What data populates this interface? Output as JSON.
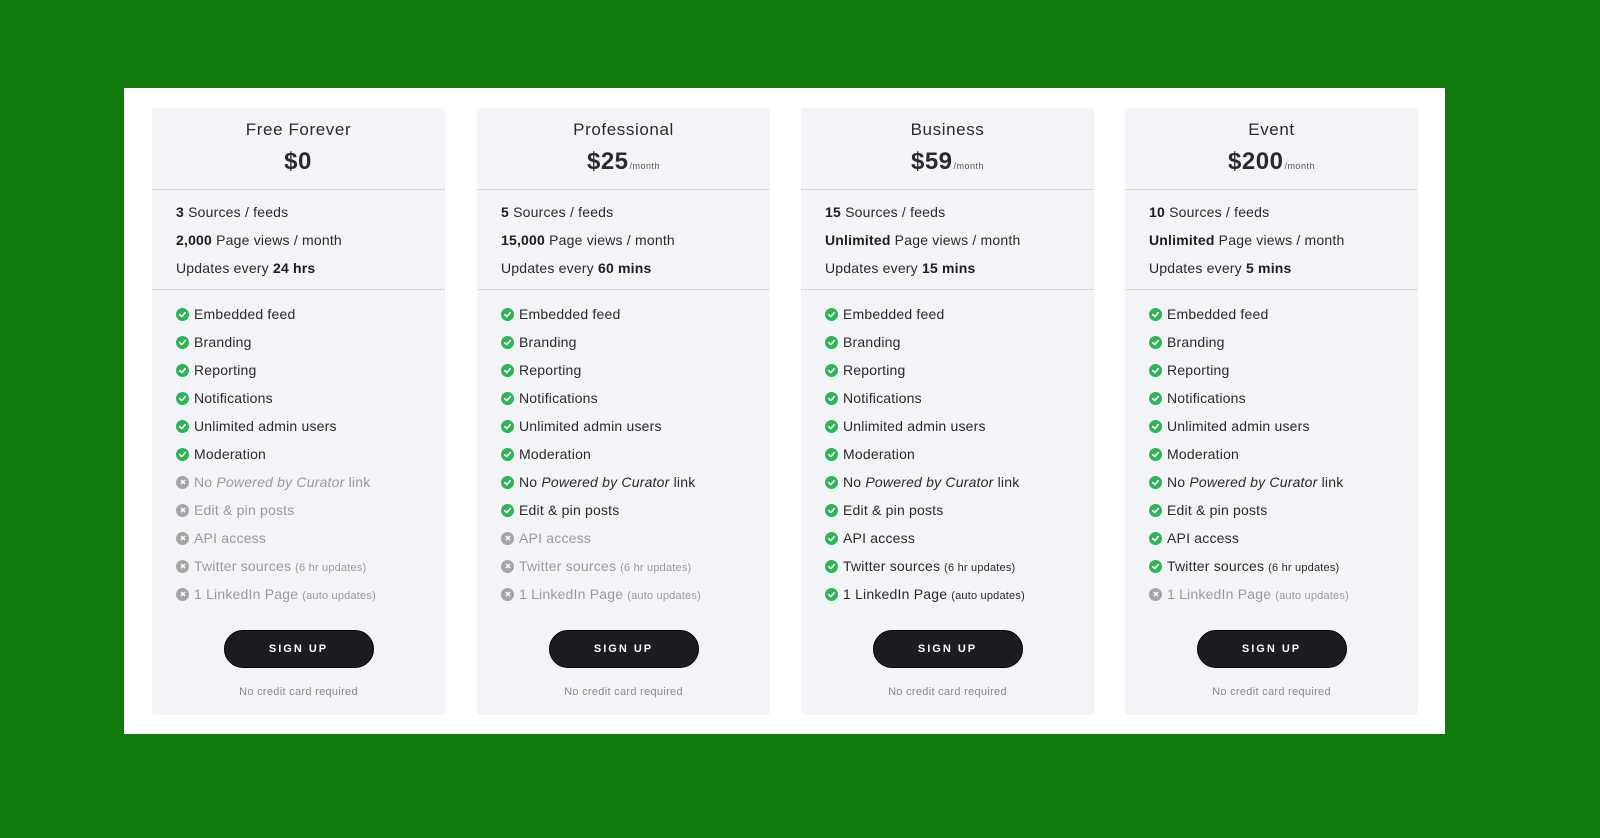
{
  "colors": {
    "background": "#107a0c",
    "frame": "#ffffff",
    "card": "#f3f4f8",
    "check": "#2fb45a",
    "cross": "#a5a5a5",
    "button": "#1c1c22"
  },
  "plans": [
    {
      "name": "Free Forever",
      "price": "$0",
      "period": "",
      "limits": [
        {
          "strong": "3",
          "text": " Sources / feeds"
        },
        {
          "strong": "2,000",
          "text": " Page views / month"
        },
        {
          "pre": "Updates every ",
          "strong": "24 hrs"
        }
      ],
      "features": [
        {
          "label": "Embedded feed",
          "on": true
        },
        {
          "label": "Branding",
          "on": true
        },
        {
          "label": "Reporting",
          "on": true
        },
        {
          "label": "Notifications",
          "on": true
        },
        {
          "label": "Unlimited admin users",
          "on": true
        },
        {
          "label": "Moderation",
          "on": true
        },
        {
          "pre": "No ",
          "em": "Powered by Curator",
          "post": " link",
          "on": false
        },
        {
          "label": "Edit & pin posts",
          "on": false
        },
        {
          "label": "API access",
          "on": false
        },
        {
          "label": "Twitter sources",
          "small": "(6 hr updates)",
          "on": false
        },
        {
          "label": "1 LinkedIn Page",
          "small": "(auto updates)",
          "on": false
        }
      ],
      "button": "SIGN UP",
      "note": "No credit card required"
    },
    {
      "name": "Professional",
      "price": "$25",
      "period": "/month",
      "limits": [
        {
          "strong": "5",
          "text": " Sources / feeds"
        },
        {
          "strong": "15,000",
          "text": " Page views / month"
        },
        {
          "pre": "Updates every ",
          "strong": "60 mins"
        }
      ],
      "features": [
        {
          "label": "Embedded feed",
          "on": true
        },
        {
          "label": "Branding",
          "on": true
        },
        {
          "label": "Reporting",
          "on": true
        },
        {
          "label": "Notifications",
          "on": true
        },
        {
          "label": "Unlimited admin users",
          "on": true
        },
        {
          "label": "Moderation",
          "on": true
        },
        {
          "pre": "No ",
          "em": "Powered by Curator",
          "post": " link",
          "on": true
        },
        {
          "label": "Edit & pin posts",
          "on": true
        },
        {
          "label": "API access",
          "on": false
        },
        {
          "label": "Twitter sources",
          "small": "(6 hr updates)",
          "on": false
        },
        {
          "label": "1 LinkedIn Page",
          "small": "(auto updates)",
          "on": false
        }
      ],
      "button": "SIGN UP",
      "note": "No credit card required"
    },
    {
      "name": "Business",
      "price": "$59",
      "period": "/month",
      "limits": [
        {
          "strong": "15",
          "text": " Sources / feeds"
        },
        {
          "strong": "Unlimited",
          "text": " Page views / month"
        },
        {
          "pre": "Updates every ",
          "strong": "15 mins"
        }
      ],
      "features": [
        {
          "label": "Embedded feed",
          "on": true
        },
        {
          "label": "Branding",
          "on": true
        },
        {
          "label": "Reporting",
          "on": true
        },
        {
          "label": "Notifications",
          "on": true
        },
        {
          "label": "Unlimited admin users",
          "on": true
        },
        {
          "label": "Moderation",
          "on": true
        },
        {
          "pre": "No ",
          "em": "Powered by Curator",
          "post": " link",
          "on": true
        },
        {
          "label": "Edit & pin posts",
          "on": true
        },
        {
          "label": "API access",
          "on": true
        },
        {
          "label": "Twitter sources",
          "small": "(6 hr updates)",
          "on": true
        },
        {
          "label": "1 LinkedIn Page",
          "small": "(auto updates)",
          "on": true
        }
      ],
      "button": "SIGN UP",
      "note": "No credit card required"
    },
    {
      "name": "Event",
      "price": "$200",
      "period": "/month",
      "limits": [
        {
          "strong": "10",
          "text": " Sources / feeds"
        },
        {
          "strong": "Unlimited",
          "text": " Page views / month"
        },
        {
          "pre": "Updates every ",
          "strong": "5 mins"
        }
      ],
      "features": [
        {
          "label": "Embedded feed",
          "on": true
        },
        {
          "label": "Branding",
          "on": true
        },
        {
          "label": "Reporting",
          "on": true
        },
        {
          "label": "Notifications",
          "on": true
        },
        {
          "label": "Unlimited admin users",
          "on": true
        },
        {
          "label": "Moderation",
          "on": true
        },
        {
          "pre": "No ",
          "em": "Powered by Curator",
          "post": " link",
          "on": true
        },
        {
          "label": "Edit & pin posts",
          "on": true
        },
        {
          "label": "API access",
          "on": true
        },
        {
          "label": "Twitter sources",
          "small": "(6 hr updates)",
          "on": true
        },
        {
          "label": "1 LinkedIn Page",
          "small": "(auto updates)",
          "on": false
        }
      ],
      "button": "SIGN UP",
      "note": "No credit card required"
    }
  ]
}
